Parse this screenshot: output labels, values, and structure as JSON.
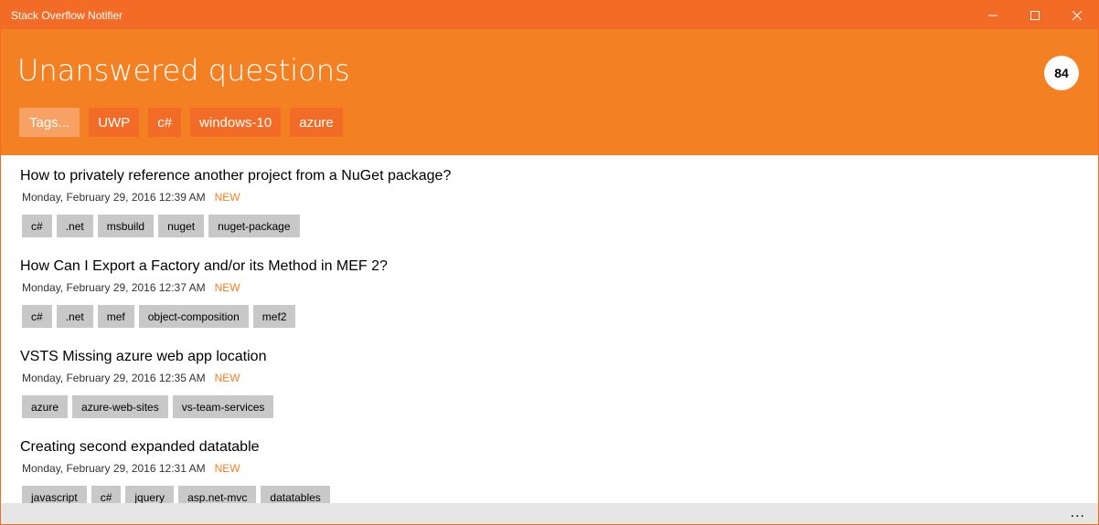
{
  "window": {
    "title": "Stack Overflow Notifier"
  },
  "header": {
    "title": "Unanswered questions",
    "count": "84",
    "tags_button": "Tags...",
    "filter_tags": [
      "UWP",
      "c#",
      "windows-10",
      "azure"
    ]
  },
  "questions": [
    {
      "title": "How to privately reference another project from a NuGet package?",
      "date": "Monday, February 29, 2016 12:39 AM",
      "status": "NEW",
      "tags": [
        "c#",
        ".net",
        "msbuild",
        "nuget",
        "nuget-package"
      ]
    },
    {
      "title": "How Can I Export a Factory and/or its Method in MEF 2?",
      "date": "Monday, February 29, 2016 12:37 AM",
      "status": "NEW",
      "tags": [
        "c#",
        ".net",
        "mef",
        "object-composition",
        "mef2"
      ]
    },
    {
      "title": "VSTS Missing azure web app location",
      "date": "Monday, February 29, 2016 12:35 AM",
      "status": "NEW",
      "tags": [
        "azure",
        "azure-web-sites",
        "vs-team-services"
      ]
    },
    {
      "title": "Creating second expanded datatable",
      "date": "Monday, February 29, 2016 12:31 AM",
      "status": "NEW",
      "tags": [
        "javascript",
        "c#",
        "jquery",
        "asp.net-mvc",
        "datatables"
      ]
    }
  ],
  "bottom_bar": {
    "more_label": "..."
  },
  "colors": {
    "titlebar": "#f26c27",
    "header": "#f48024",
    "accent": "#f48024",
    "tag_bg": "#c8c8c8"
  }
}
